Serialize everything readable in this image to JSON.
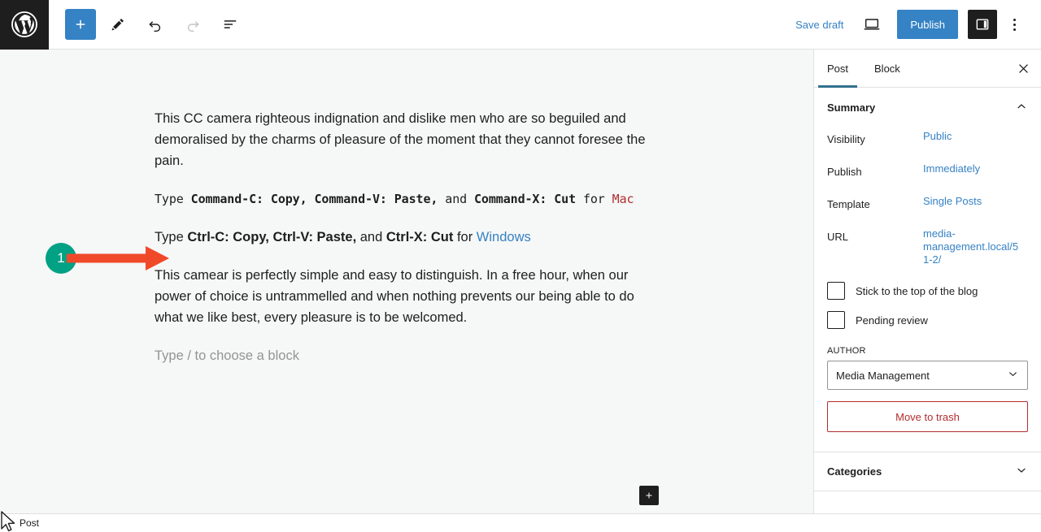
{
  "topbar": {
    "logo_icon": "wordpress-logo-icon",
    "tools": [
      {
        "name": "block-inserter-button",
        "icon": "plus-icon",
        "label": "Toggle block inserter"
      },
      {
        "name": "tools-pencil-button",
        "icon": "pencil-icon",
        "label": "Tools"
      },
      {
        "name": "undo-button",
        "icon": "undo-arrow-icon",
        "label": "Undo"
      },
      {
        "name": "redo-button",
        "icon": "redo-arrow-icon",
        "label": "Redo"
      },
      {
        "name": "document-overview-button",
        "icon": "list-view-icon",
        "label": "Document Overview"
      }
    ],
    "save_draft_label": "Save draft",
    "preview_icon": "laptop-preview-icon",
    "publish_label": "Publish",
    "settings_toggle_icon": "sidebar-panel-icon",
    "options_icon": "kebab-menu-icon",
    "accent_blue": "#3582c4",
    "dark": "#1e1e1e"
  },
  "editor": {
    "paragraphs": [
      {
        "kind": "plain",
        "text": "This CC camera righteous indignation and dislike men who are so beguiled and demoralised by the charms of pleasure of the moment that they cannot foresee the pain."
      },
      {
        "kind": "mono",
        "lead": "Type ",
        "code1": "Command-C: Copy,",
        "code2": "Command-V: Paste,",
        "conj": " and ",
        "code3": "Command-X: Cut",
        "tail": " for ",
        "platform": "Mac",
        "platform_color": "#b32d2e"
      },
      {
        "kind": "plain-rich",
        "lead": "Type ",
        "code1": "Ctrl-C: Copy,",
        "code2": "Ctrl-V: Paste,",
        "conj": " and ",
        "code3": "Ctrl-X: Cut",
        "tail": " for ",
        "platform": "Windows",
        "platform_color": "#3582c4"
      },
      {
        "kind": "plain",
        "text": "This camear is perfectly simple and easy to distinguish. In a free hour, when our power of choice is untrammelled and when nothing prevents our being able to do what we like best, every pleasure is to be welcomed."
      }
    ],
    "placeholder": "Type / to choose a block",
    "appender_icon": "plus-icon"
  },
  "annotation": {
    "number": "1",
    "badge_color": "#00a184",
    "arrow_color": "#f0492a",
    "arrow_icon": "right-arrow-icon"
  },
  "sidebar": {
    "tabs": [
      {
        "name": "tab-post",
        "label": "Post",
        "active": true
      },
      {
        "name": "tab-block",
        "label": "Block",
        "active": false
      }
    ],
    "close_icon": "close-icon",
    "active_underline_color": "#31708e",
    "summary": {
      "title": "Summary",
      "chevron_icon": "chevron-up-icon",
      "rows": [
        {
          "label": "Visibility",
          "value": "Public",
          "name": "visibility"
        },
        {
          "label": "Publish",
          "value": "Immediately",
          "name": "publish-date"
        },
        {
          "label": "Template",
          "value": "Single Posts",
          "name": "template"
        },
        {
          "label": "URL",
          "value": "media-management.local/51-2/",
          "name": "url"
        }
      ],
      "checkboxes": [
        {
          "label": "Stick to the top of the blog",
          "checked": false,
          "name": "sticky"
        },
        {
          "label": "Pending review",
          "checked": false,
          "name": "pending-review"
        }
      ],
      "author_label": "AUTHOR",
      "author_value": "Media Management",
      "author_chevron_icon": "chevron-down-icon",
      "trash_label": "Move to trash",
      "trash_color": "#b32d2e"
    },
    "categories": {
      "title": "Categories",
      "chevron_icon": "chevron-down-icon"
    }
  },
  "statusbar": {
    "breadcrumb": "Post"
  }
}
